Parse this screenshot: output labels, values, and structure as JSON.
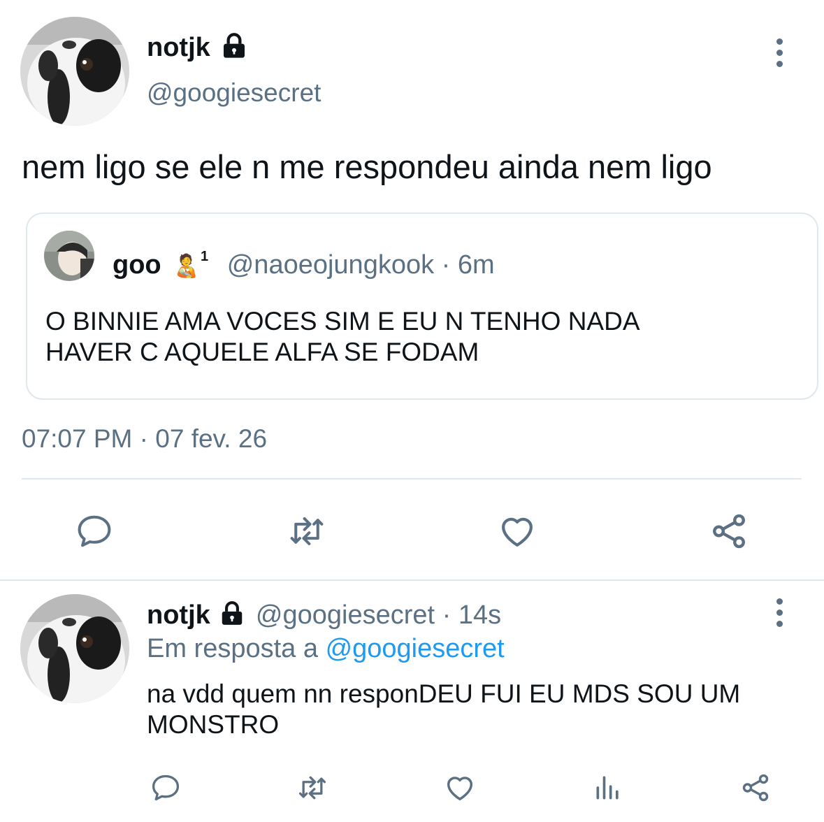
{
  "main_tweet": {
    "author_name": "notjk",
    "handle": "@googiesecret",
    "text": "nem ligo se ele n me respondeu ainda nem ligo",
    "quote": {
      "author_name": "goo",
      "emoji": "🧑‍🍼",
      "superscript": "1",
      "handle": "@naoeojungkook",
      "separator": "·",
      "time": "6m",
      "text_line1": "O BINNIE AMA VOCES SIM E EU N TENHO NADA",
      "text_line2": "HAVER C AQUELE ALFA SE FODAM"
    },
    "time": "07:07 PM",
    "separator": "·",
    "date": "07 fev. 26"
  },
  "reply": {
    "author_name": "notjk",
    "handle": "@googiesecret",
    "separator": "·",
    "time": "14s",
    "reply_prefix": "Em resposta a",
    "reply_to": "@googiesecret",
    "text_line1": "na vdd quem nn responDEU FUI EU MDS SOU UM",
    "text_line2": "MONSTRO"
  },
  "icons": {
    "lock": "lock-icon",
    "more": "more-vertical-icon",
    "reply": "reply-icon",
    "retweet": "retweet-icon",
    "like": "heart-icon",
    "share": "share-icon",
    "analytics": "analytics-icon"
  },
  "colors": {
    "text": "#0f1419",
    "muted": "#5b7083",
    "link": "#1d9bf0",
    "border": "#e1e8ed"
  }
}
